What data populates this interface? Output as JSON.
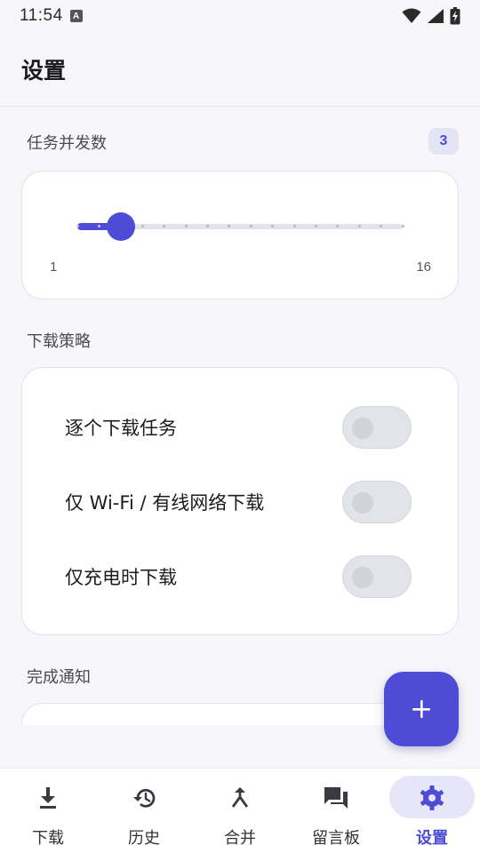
{
  "status_bar": {
    "time": "11:54",
    "notification_icon_letter": "A"
  },
  "app_bar": {
    "title": "设置"
  },
  "concurrency": {
    "heading": "任务并发数",
    "badge_value": "3",
    "slider": {
      "min": 1,
      "max": 16,
      "value": 3,
      "min_label": "1",
      "max_label": "16"
    }
  },
  "strategy": {
    "heading": "下载策略",
    "options": [
      {
        "label": "逐个下载任务",
        "enabled": false
      },
      {
        "label": "仅 Wi-Fi / 有线网络下载",
        "enabled": false
      },
      {
        "label": "仅充电时下载",
        "enabled": false
      }
    ]
  },
  "notification": {
    "heading": "完成通知"
  },
  "fab": {
    "icon": "plus-icon"
  },
  "bottom_nav": {
    "items": [
      {
        "label": "下载",
        "icon": "download-icon",
        "active": false
      },
      {
        "label": "历史",
        "icon": "history-icon",
        "active": false
      },
      {
        "label": "合并",
        "icon": "merge-icon",
        "active": false
      },
      {
        "label": "留言板",
        "icon": "forum-icon",
        "active": false
      },
      {
        "label": "设置",
        "icon": "gear-icon",
        "active": true
      }
    ]
  },
  "colors": {
    "accent": "#4e4bd6",
    "accent_container": "#e6e6f8",
    "background": "#f7f7f9",
    "card": "#ffffff"
  }
}
